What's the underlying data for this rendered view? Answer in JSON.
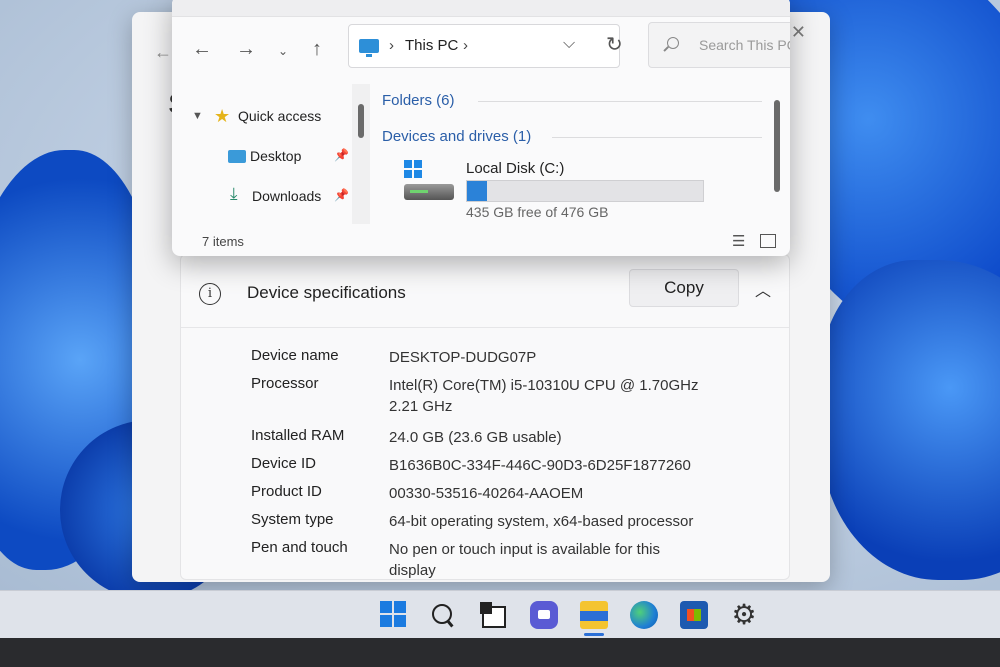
{
  "explorer": {
    "address_root": "This PC",
    "search_placeholder": "Search This PC",
    "nav": {
      "quick_access": "Quick access",
      "desktop": "Desktop",
      "downloads": "Downloads"
    },
    "groups": {
      "folders": "Folders (6)",
      "devices": "Devices and drives (1)"
    },
    "drive": {
      "name": "Local Disk (C:)",
      "free_text": "435 GB free of 476 GB",
      "used_fraction": 0.086
    },
    "status": "7 items"
  },
  "settings": {
    "section_title": "Device specifications",
    "copy_label": "Copy",
    "specs": [
      {
        "label": "Device name",
        "value": "DESKTOP-DUDG07P"
      },
      {
        "label": "Processor",
        "value": "Intel(R) Core(TM) i5-10310U CPU @ 1.70GHz   2.21 GHz"
      },
      {
        "label": "Installed RAM",
        "value": "24.0 GB (23.6 GB usable)"
      },
      {
        "label": "Device ID",
        "value": "B1636B0C-334F-446C-90D3-6D25F1877260"
      },
      {
        "label": "Product ID",
        "value": "00330-53516-40264-AAOEM"
      },
      {
        "label": "System type",
        "value": "64-bit operating system, x64-based processor"
      },
      {
        "label": "Pen and touch",
        "value": "No pen or touch input is available for this display"
      }
    ]
  },
  "colors": {
    "accent": "#2b82d8",
    "taskbar": "#dfe3ea"
  },
  "icons": [
    "back-arrow-icon",
    "forward-arrow-icon",
    "up-arrow-icon",
    "refresh-icon",
    "search-icon",
    "star-icon",
    "desktop-icon",
    "download-icon",
    "pin-icon",
    "windows-logo-icon",
    "drive-icon",
    "info-icon",
    "chevron-up-icon",
    "gear-icon"
  ]
}
